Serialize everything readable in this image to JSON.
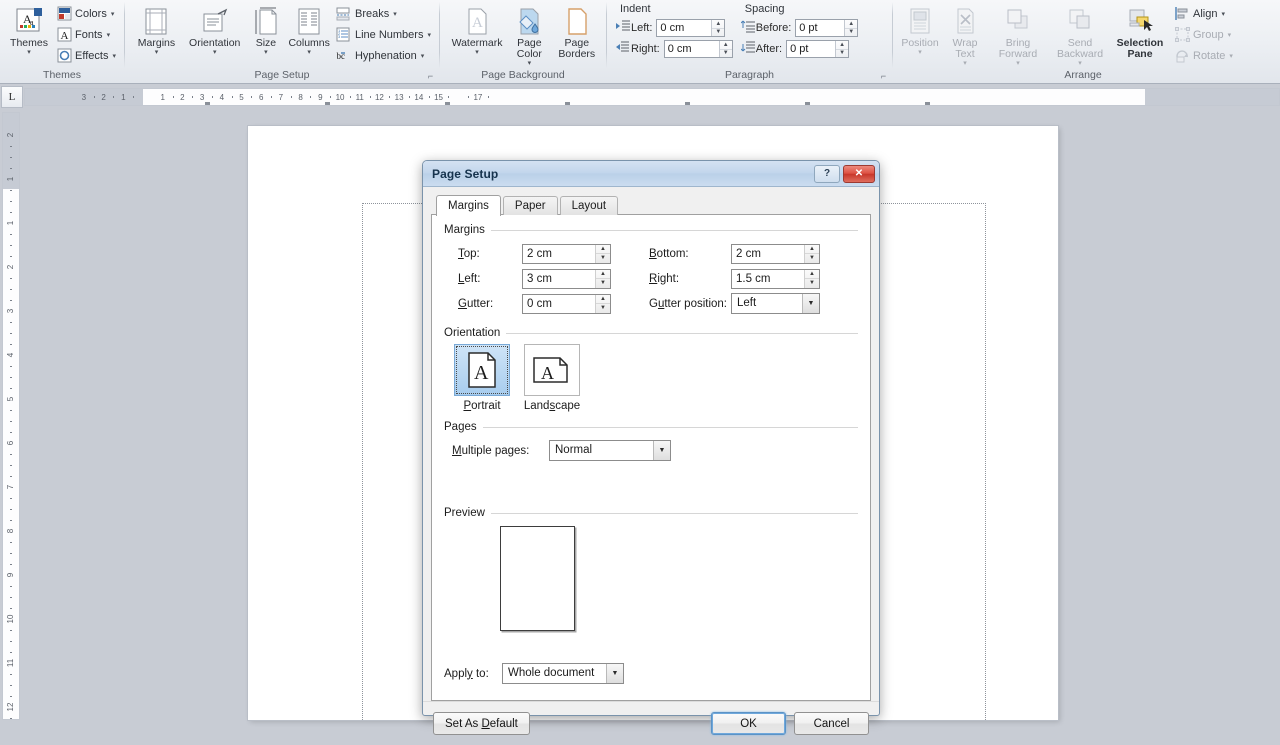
{
  "ribbon": {
    "groups": [
      {
        "name": "Themes",
        "label": "Themes",
        "big": [
          {
            "label": "Themes",
            "icon": "themes-icon",
            "arrow": "▾"
          }
        ],
        "small": [
          {
            "label": "Colors",
            "icon": "colors-icon",
            "arrow": "▾"
          },
          {
            "label": "Fonts",
            "icon": "fonts-icon",
            "arrow": "▾"
          },
          {
            "label": "Effects",
            "icon": "effects-icon",
            "arrow": "▾"
          }
        ]
      },
      {
        "name": "Page Setup",
        "label": "Page Setup",
        "big": [
          {
            "label": "Margins",
            "icon": "margins-icon",
            "arrow": "▾"
          },
          {
            "label": "Orientation",
            "icon": "orientation-icon",
            "arrow": "▾"
          },
          {
            "label": "Size",
            "icon": "size-icon",
            "arrow": "▾"
          },
          {
            "label": "Columns",
            "icon": "columns-icon",
            "arrow": "▾"
          }
        ],
        "small": [
          {
            "label": "Breaks",
            "icon": "breaks-icon",
            "arrow": "▾"
          },
          {
            "label": "Line Numbers",
            "icon": "line-numbers-icon",
            "arrow": "▾"
          },
          {
            "label": "Hyphenation",
            "icon": "hyphenation-icon",
            "arrow": "▾"
          }
        ]
      },
      {
        "name": "Page Background",
        "label": "Page Background",
        "big": [
          {
            "label": "Watermark",
            "icon": "watermark-icon",
            "arrow": "▾"
          },
          {
            "label": "Page Color",
            "icon": "page-color-icon",
            "arrow": "▾"
          },
          {
            "label": "Page Borders",
            "icon": "page-borders-icon",
            "arrow": ""
          }
        ]
      },
      {
        "name": "Paragraph",
        "label": "Paragraph",
        "indent_title": "Indent",
        "spacing_title": "Spacing",
        "fields": [
          {
            "label": "Left:",
            "value": "0 cm"
          },
          {
            "label": "Right:",
            "value": "0 cm"
          },
          {
            "label": "Before:",
            "value": "0 pt"
          },
          {
            "label": "After:",
            "value": "0 pt"
          }
        ]
      },
      {
        "name": "Arrange",
        "label": "Arrange",
        "big": [
          {
            "label": "Position",
            "icon": "position-icon",
            "arrow": "▾",
            "dim": true
          },
          {
            "label": "Wrap Text",
            "icon": "wrap-text-icon",
            "arrow": "▾",
            "dim": true
          },
          {
            "label": "Bring Forward",
            "icon": "bring-forward-icon",
            "arrow": "▾",
            "dim": true
          },
          {
            "label": "Send Backward",
            "icon": "send-backward-icon",
            "arrow": "▾",
            "dim": true
          },
          {
            "label": "Selection Pane",
            "icon": "selection-pane-icon",
            "arrow": "",
            "dim": false
          }
        ],
        "small": [
          {
            "label": "Align",
            "icon": "align-icon",
            "arrow": "▾",
            "dim": false
          },
          {
            "label": "Group",
            "icon": "group-icon",
            "arrow": "▾",
            "dim": true
          },
          {
            "label": "Rotate",
            "icon": "rotate-icon",
            "arrow": "▾",
            "dim": true
          }
        ]
      }
    ]
  },
  "rulers": {
    "tab_selector": "L",
    "horizontal_ticks": [
      "3",
      "2",
      "1",
      "1",
      "1",
      "2",
      "3",
      "4",
      "5",
      "6",
      "7",
      "8",
      "9",
      "10",
      "11",
      "12",
      "13",
      "14",
      "15",
      "17"
    ],
    "vertical_ticks": [
      "2",
      "1",
      "1",
      "2",
      "3",
      "4",
      "5",
      "6",
      "7",
      "8",
      "9",
      "10",
      "11",
      "12"
    ]
  },
  "dialog": {
    "title": "Page Setup",
    "help_button": "?",
    "close_button": "✕",
    "tabs": [
      {
        "label": "Margins",
        "active": true
      },
      {
        "label": "Paper",
        "active": false
      },
      {
        "label": "Layout",
        "active": false
      }
    ],
    "margins": {
      "legend": "Margins",
      "top_label": "Top:",
      "top_value": "2 cm",
      "bottom_label": "Bottom:",
      "bottom_value": "2 cm",
      "left_label": "Left:",
      "left_value": "3 cm",
      "right_label": "Right:",
      "right_value": "1.5 cm",
      "gutter_label": "Gutter:",
      "gutter_value": "0 cm",
      "gutter_position_label": "Gutter position:",
      "gutter_position_value": "Left"
    },
    "orientation": {
      "legend": "Orientation",
      "portrait_label": "Portrait",
      "landscape_label": "Landscape",
      "selected": "Portrait"
    },
    "pages": {
      "legend": "Pages",
      "multiple_pages_label": "Multiple pages:",
      "multiple_pages_value": "Normal"
    },
    "preview": {
      "legend": "Preview",
      "apply_to_label": "Apply to:",
      "apply_to_value": "Whole document"
    },
    "footer": {
      "set_as_default": "Set As Default",
      "ok": "OK",
      "cancel": "Cancel"
    }
  },
  "colors": {
    "app_background": "#c8ccd4",
    "dialog_titlebar": "#c3d6ec",
    "close_button": "#c8382b",
    "selection_highlight": "#a8cdee",
    "focus_ring": "#6fa8dc"
  }
}
